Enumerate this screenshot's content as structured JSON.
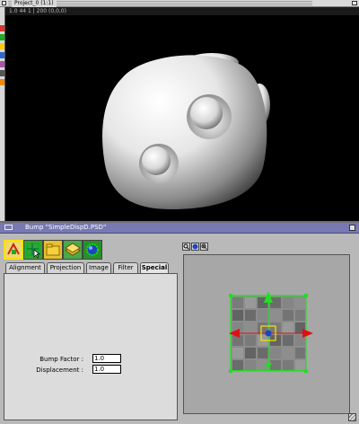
{
  "top_window": {
    "title": "Project_0 (1:1)",
    "info_text": "1.0 44 1 | 200 (0,0,0)"
  },
  "panel": {
    "title": "Bump \"SimpleDispD.PSD\"",
    "tabs": [
      "Alignment",
      "Projection",
      "Image",
      "Filter",
      "Special"
    ],
    "active_tab": "Special",
    "fields": {
      "bump_factor_label": "Bump Factor :",
      "bump_factor_value": "1.0",
      "displacement_label": "Displacement :",
      "displacement_value": "1.0"
    },
    "toolbar_icons": [
      "alignment-tool-icon",
      "grid-select-tool-icon",
      "folder-tool-icon",
      "layer-tool-icon",
      "sphere-tool-icon"
    ],
    "view_icons": [
      "magnify-icon",
      "sphere-view-icon",
      "zoom-icon"
    ]
  },
  "colors": {
    "panel_titlebar": "#7878b2",
    "handle_green": "#22dd22",
    "handle_red": "#dd1111",
    "selection_yellow": "#ffe000"
  }
}
